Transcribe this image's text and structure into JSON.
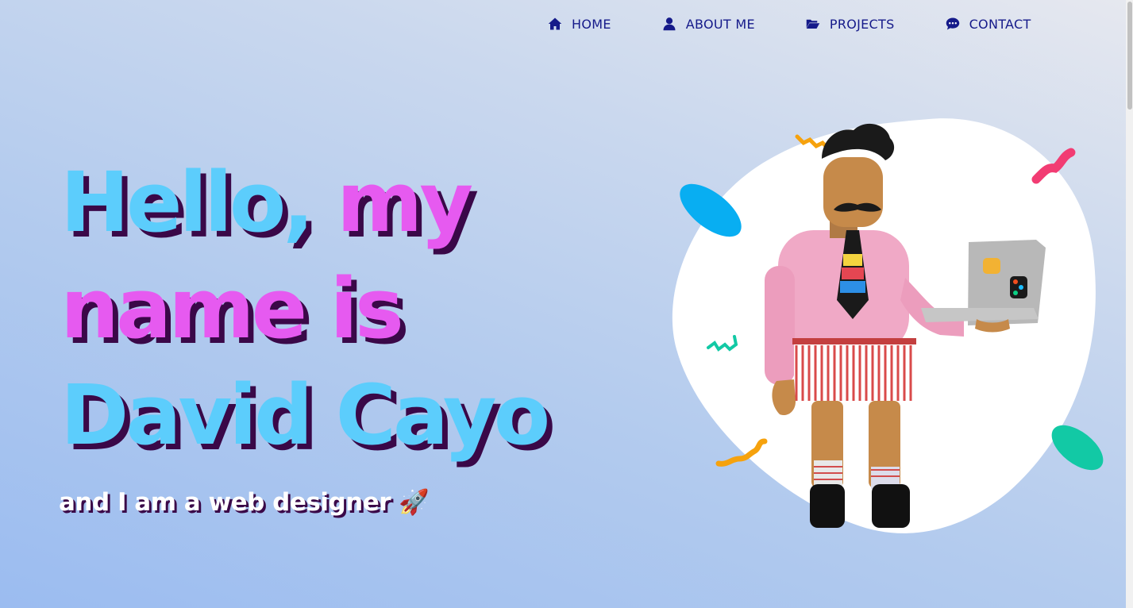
{
  "nav": {
    "items": [
      {
        "label": "HOME",
        "icon": "home-icon"
      },
      {
        "label": "ABOUT ME",
        "icon": "user-icon"
      },
      {
        "label": "PROJECTS",
        "icon": "folder-open-icon"
      },
      {
        "label": "CONTACT",
        "icon": "chat-icon"
      }
    ]
  },
  "hero": {
    "line1_a": "Hello,",
    "line1_b": "my",
    "line2": "name is",
    "line3": "David Cayo",
    "subtitle": "and I am a web designer",
    "subtitle_emoji": "🚀"
  },
  "colors": {
    "nav_text": "#151a8a",
    "heading_blue": "#5ccdfc",
    "heading_pink": "#e65af0",
    "heading_shadow": "#3a0848",
    "subtitle": "#ffffff"
  },
  "illustration": {
    "subject": "3D character holding laptop on white blob",
    "icons": [
      "confetti-squiggle",
      "laptop-icon",
      "figma-sticker",
      "sketch-sticker"
    ]
  }
}
